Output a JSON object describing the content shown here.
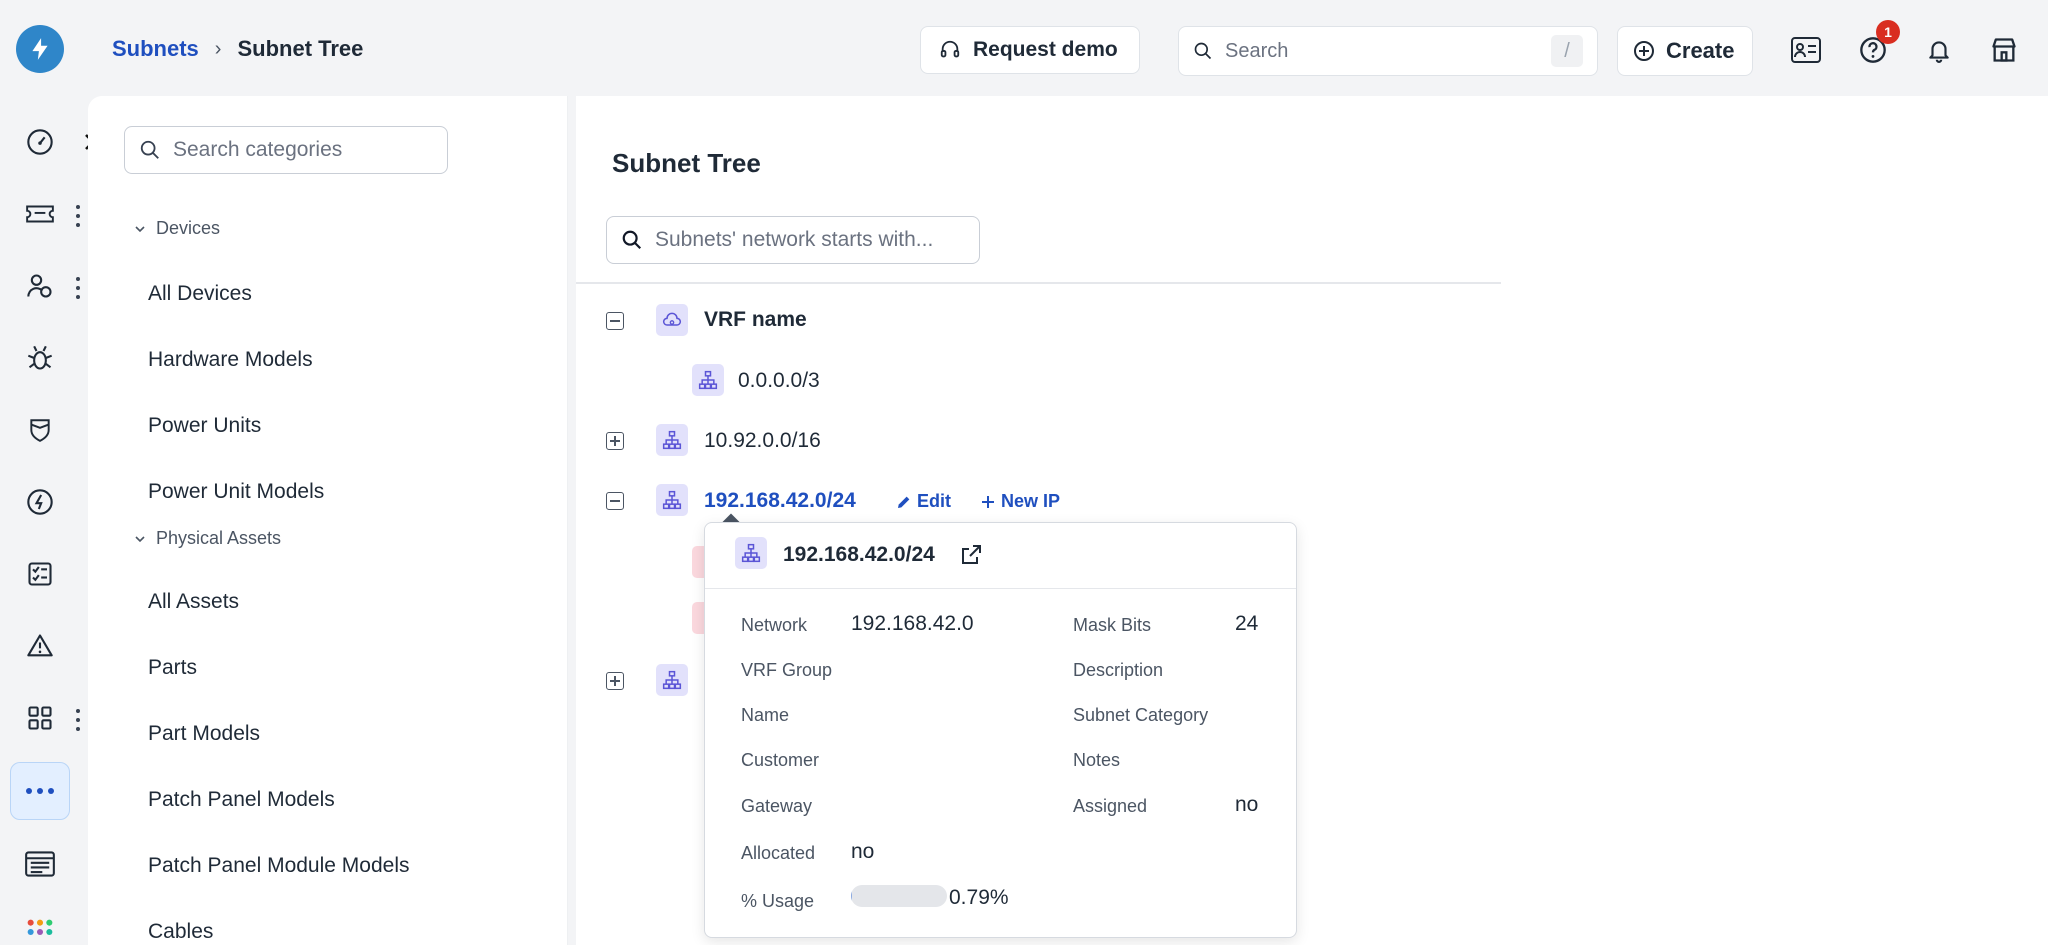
{
  "header": {
    "breadcrumb": {
      "parent": "Subnets",
      "current": "Subnet Tree"
    },
    "request_demo_label": "Request demo",
    "search_placeholder": "Search",
    "search_shortcut": "/",
    "create_label": "Create",
    "help_badge_count": "1"
  },
  "rail": {
    "items": [
      "dashboard-icon",
      "ticket-icon",
      "people-icon",
      "bug-icon",
      "shield-icon",
      "speedometer-icon",
      "checklist-icon",
      "warning-icon",
      "apps-grid-icon",
      "more-icon",
      "browser-window-icon",
      "app-launcher-icon"
    ]
  },
  "categories": {
    "search_placeholder": "Search categories",
    "groups": [
      {
        "label": "Devices",
        "items": [
          "All Devices",
          "Hardware Models",
          "Power Units",
          "Power Unit Models"
        ]
      },
      {
        "label": "Physical Assets",
        "items": [
          "All Assets",
          "Parts",
          "Part Models",
          "Patch Panel Models",
          "Patch Panel Module Models",
          "Cables"
        ]
      }
    ]
  },
  "main": {
    "title": "Subnet Tree",
    "search_placeholder": "Subnets' network starts with...",
    "tree": {
      "vrf_label": "VRF name",
      "child_subnet": "0.0.0.0/3",
      "subnet_2": "10.92.0.0/16",
      "subnet_3": "192.168.42.0/24",
      "edit_label": "Edit",
      "new_ip_label": "New IP"
    }
  },
  "popover": {
    "title": "192.168.42.0/24",
    "fields": {
      "network_label": "Network",
      "network_value": "192.168.42.0",
      "mask_bits_label": "Mask Bits",
      "mask_bits_value": "24",
      "vrf_group_label": "VRF Group",
      "description_label": "Description",
      "name_label": "Name",
      "subnet_category_label": "Subnet Category",
      "customer_label": "Customer",
      "notes_label": "Notes",
      "gateway_label": "Gateway",
      "assigned_label": "Assigned",
      "assigned_value": "no",
      "allocated_label": "Allocated",
      "allocated_value": "no",
      "usage_label": "% Usage",
      "usage_value": "0.79%"
    },
    "usage_fraction": 0.0079
  },
  "colors": {
    "accent": "#1f4fbf",
    "logo": "#2f86c9",
    "badge": "#d92d20",
    "node_icon_bg": "#e2e1fb"
  }
}
